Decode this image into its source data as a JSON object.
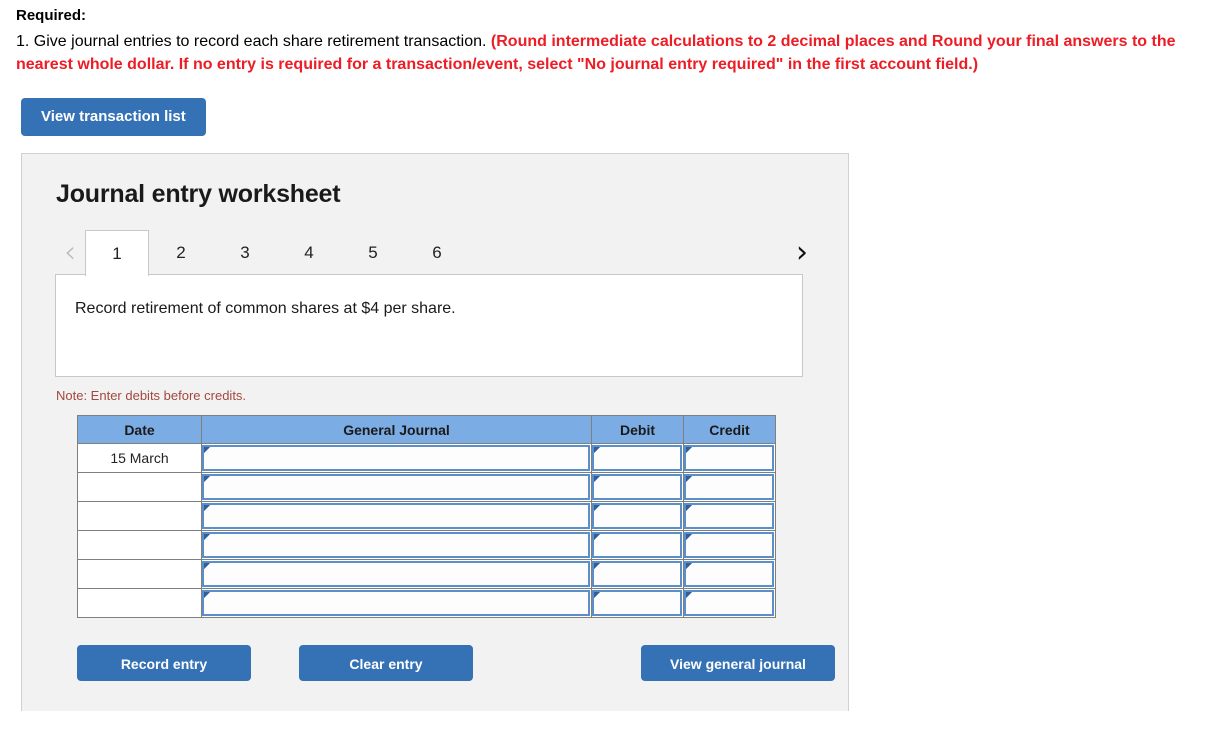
{
  "required": {
    "label": "Required:",
    "item_number": "1.",
    "instruction": "Give journal entries to record each share retirement transaction.",
    "emphasis": "(Round intermediate calculations to 2 decimal places and Round your final answers to the nearest whole dollar. If no entry is required for a transaction/event, select \"No journal entry required\" in the first account field.)"
  },
  "toolbar": {
    "view_transaction_list_label": "View transaction list"
  },
  "worksheet": {
    "title": "Journal entry worksheet",
    "prev_icon": "chevron-left-icon",
    "next_icon": "chevron-right-icon",
    "prev_glyph": "‹",
    "next_glyph": "›",
    "tabs": [
      {
        "label": "1",
        "active": true
      },
      {
        "label": "2",
        "active": false
      },
      {
        "label": "3",
        "active": false
      },
      {
        "label": "4",
        "active": false
      },
      {
        "label": "5",
        "active": false
      },
      {
        "label": "6",
        "active": false
      }
    ],
    "scenario_text": "Record retirement of common shares at $4 per share.",
    "note": "Note: Enter debits before credits."
  },
  "journal_table": {
    "headers": [
      "Date",
      "General Journal",
      "Debit",
      "Credit"
    ],
    "rows": [
      {
        "date": "15 March",
        "general_journal": "",
        "debit": "",
        "credit": ""
      },
      {
        "date": "",
        "general_journal": "",
        "debit": "",
        "credit": ""
      },
      {
        "date": "",
        "general_journal": "",
        "debit": "",
        "credit": ""
      },
      {
        "date": "",
        "general_journal": "",
        "debit": "",
        "credit": ""
      },
      {
        "date": "",
        "general_journal": "",
        "debit": "",
        "credit": ""
      },
      {
        "date": "",
        "general_journal": "",
        "debit": "",
        "credit": ""
      }
    ]
  },
  "actions": {
    "record_entry_label": "Record entry",
    "clear_entry_label": "Clear entry",
    "view_general_journal_label": "View general journal"
  },
  "colors": {
    "button_blue": "#3571b5",
    "table_header_blue": "#7cace4",
    "field_border_blue": "#5b8fc9",
    "marker_blue": "#2f5f9e",
    "emphasis_red": "#ee1c25",
    "note_red": "#a3483f",
    "panel_bg": "#f2f2f2"
  }
}
